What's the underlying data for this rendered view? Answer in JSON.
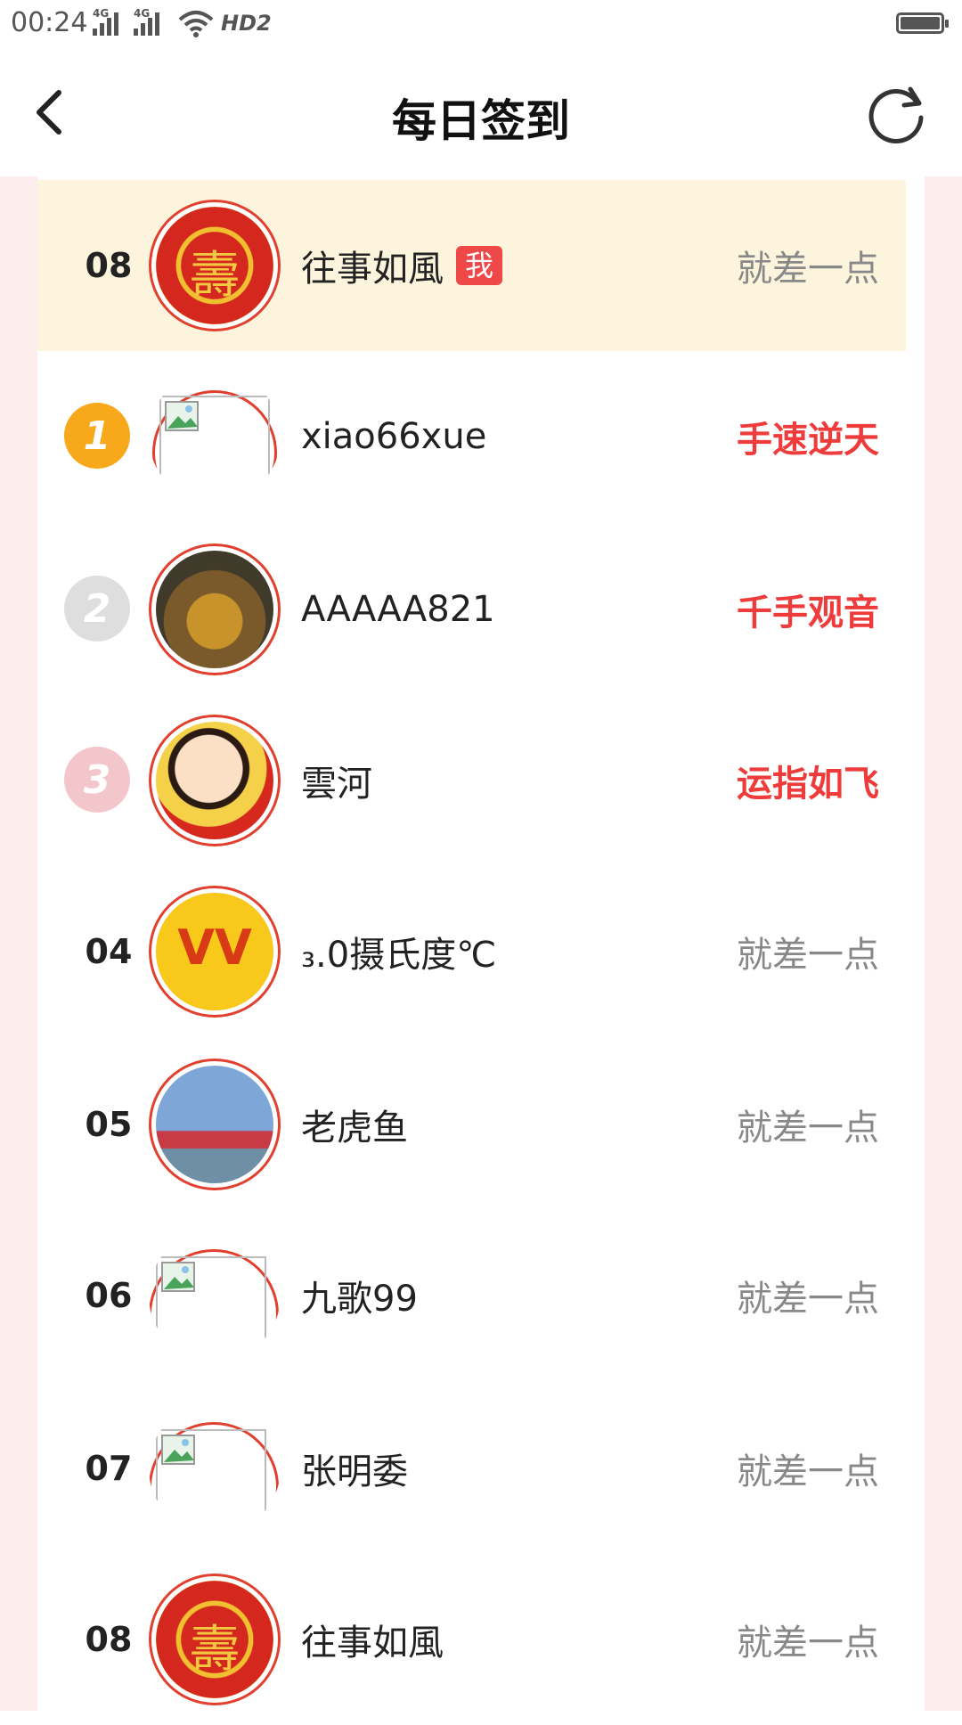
{
  "status_bar": {
    "time": "00:24",
    "signal1_tag": "4G",
    "signal2_tag": "4G",
    "hd_label": "HD2"
  },
  "header": {
    "title": "每日签到",
    "back_icon": "chevron-left-icon",
    "refresh_icon": "refresh-icon"
  },
  "my_row": {
    "rank": "08",
    "name": "往事如風",
    "me_badge": "我",
    "status": "就差一点"
  },
  "rows": [
    {
      "rank": "1",
      "medal": "gold",
      "name": "xiao66xue",
      "status": "手速逆天",
      "avatar": "broken-image"
    },
    {
      "rank": "2",
      "medal": "silver",
      "name": "AAAAA821",
      "status": "千手观音",
      "avatar": "golden-horse"
    },
    {
      "rank": "3",
      "medal": "bronze",
      "name": "雲河",
      "status": "运指如飞",
      "avatar": "cartoon-boy"
    },
    {
      "rank": "04",
      "name": "₃.0摄氏度℃",
      "status": "就差一点",
      "avatar": "victory-hands"
    },
    {
      "rank": "05",
      "name": "老虎鱼",
      "status": "就差一点",
      "avatar": "lake-scene"
    },
    {
      "rank": "06",
      "name": "九歌99",
      "status": "就差一点",
      "avatar": "broken-image"
    },
    {
      "rank": "07",
      "name": "张明委",
      "status": "就差一点",
      "avatar": "broken-image"
    },
    {
      "rank": "08",
      "name": "往事如風",
      "status": "就差一点",
      "avatar": "seal"
    }
  ],
  "colors": {
    "accent_red": "#ee3c3c",
    "me_row_bg": "#fcf4dc",
    "page_bg": "#fdeded",
    "avatar_border": "#e2402f"
  }
}
